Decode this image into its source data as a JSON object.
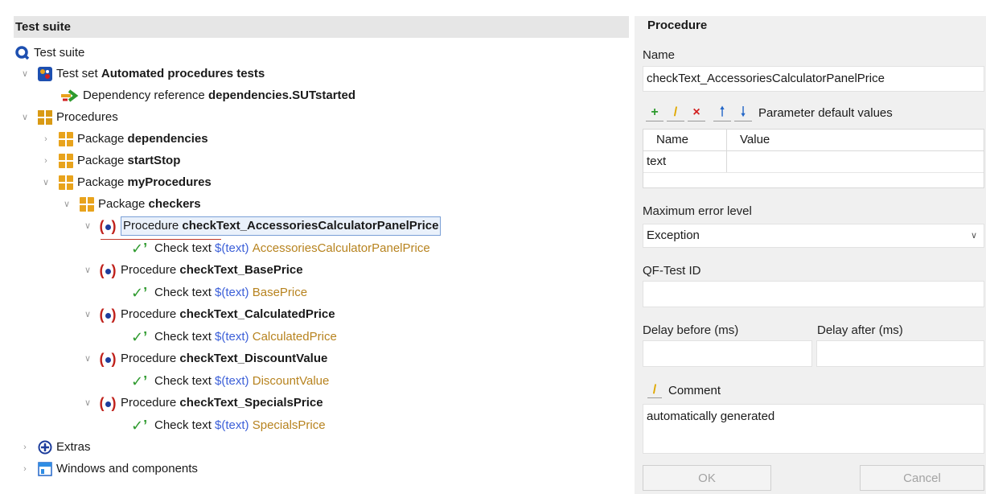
{
  "left_panel": {
    "header": "Test suite",
    "tree": {
      "root": {
        "prefix": "Test suite",
        "name": ""
      },
      "test_set": {
        "prefix": "Test set",
        "name": "Automated procedures tests"
      },
      "dependency_ref": {
        "prefix": "Dependency reference",
        "name": "dependencies.SUTstarted"
      },
      "procedures": {
        "prefix": "Procedures",
        "name": ""
      },
      "pkg_dependencies": {
        "prefix": "Package",
        "name": "dependencies"
      },
      "pkg_startstop": {
        "prefix": "Package",
        "name": "startStop"
      },
      "pkg_myprocedures": {
        "prefix": "Package",
        "name": "myProcedures"
      },
      "pkg_checkers": {
        "prefix": "Package",
        "name": "checkers"
      },
      "procedures_list": [
        {
          "prefix": "Procedure",
          "name": "checkText_AccessoriesCalculatorPanelPrice",
          "check_prefix": "Check text",
          "check_var": "$(text)",
          "check_value": "AccessoriesCalculatorPanelPrice"
        },
        {
          "prefix": "Procedure",
          "name": "checkText_BasePrice",
          "check_prefix": "Check text",
          "check_var": "$(text)",
          "check_value": "BasePrice"
        },
        {
          "prefix": "Procedure",
          "name": "checkText_CalculatedPrice",
          "check_prefix": "Check text",
          "check_var": "$(text)",
          "check_value": "CalculatedPrice"
        },
        {
          "prefix": "Procedure",
          "name": "checkText_DiscountValue",
          "check_prefix": "Check text",
          "check_var": "$(text)",
          "check_value": "DiscountValue"
        },
        {
          "prefix": "Procedure",
          "name": "checkText_SpecialsPrice",
          "check_prefix": "Check text",
          "check_var": "$(text)",
          "check_value": "SpecialsPrice"
        }
      ],
      "extras": "Extras",
      "windows": "Windows and components"
    }
  },
  "right_panel": {
    "title": "Procedure",
    "name_label": "Name",
    "name_value": "checkText_AccessoriesCalculatorPanelPrice",
    "param_label": "Parameter default values",
    "param_columns": [
      "Name",
      "Value"
    ],
    "param_rows": [
      {
        "name": "text",
        "value": ""
      }
    ],
    "max_error_label": "Maximum error level",
    "max_error_value": "Exception",
    "qf_id_label": "QF-Test ID",
    "qf_id_value": "",
    "delay_before_label": "Delay before (ms)",
    "delay_after_label": "Delay after (ms)",
    "comment_label": "Comment",
    "comment_value": "automatically generated",
    "ok_label": "OK",
    "cancel_label": "Cancel"
  }
}
